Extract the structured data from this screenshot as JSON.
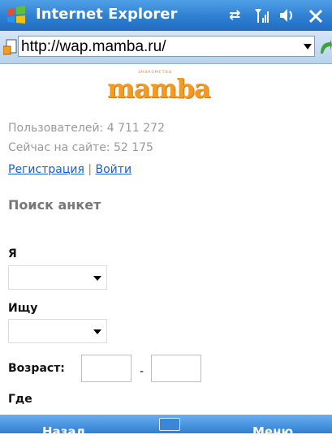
{
  "window": {
    "title": "Internet Explorer"
  },
  "address_bar": {
    "url": "http://wap.mamba.ru/"
  },
  "logo": {
    "tagline": "знакомства",
    "text": "mamba",
    "brand_color": "#f39a20"
  },
  "stats": {
    "users": "Пользователей: 4 711 272",
    "online": "Сейчас на сайте: 52 175"
  },
  "auth_links": {
    "register": "Регистрация",
    "separator": "|",
    "login": "Войти"
  },
  "search": {
    "heading": "Поиск анкет",
    "i_label": "Я",
    "i_value": "",
    "seek_label": "Ищу",
    "seek_value": "",
    "age_label": "Возраст:",
    "age_from": "",
    "age_separator": "-",
    "age_to": "",
    "where_label": "Где"
  },
  "softkeys": {
    "left": "Назад",
    "right": "Меню"
  },
  "icons": {
    "titlebar": [
      "windows-start-icon",
      "connectivity-icon",
      "signal-icon",
      "volume-icon",
      "close-icon"
    ],
    "address": [
      "page-icon",
      "go-icon"
    ],
    "softbar": [
      "keyboard-icon"
    ]
  },
  "colors": {
    "title_bar": "#2f7fd2",
    "link": "#1a5fcc",
    "stat_text": "#9a9a9a"
  }
}
